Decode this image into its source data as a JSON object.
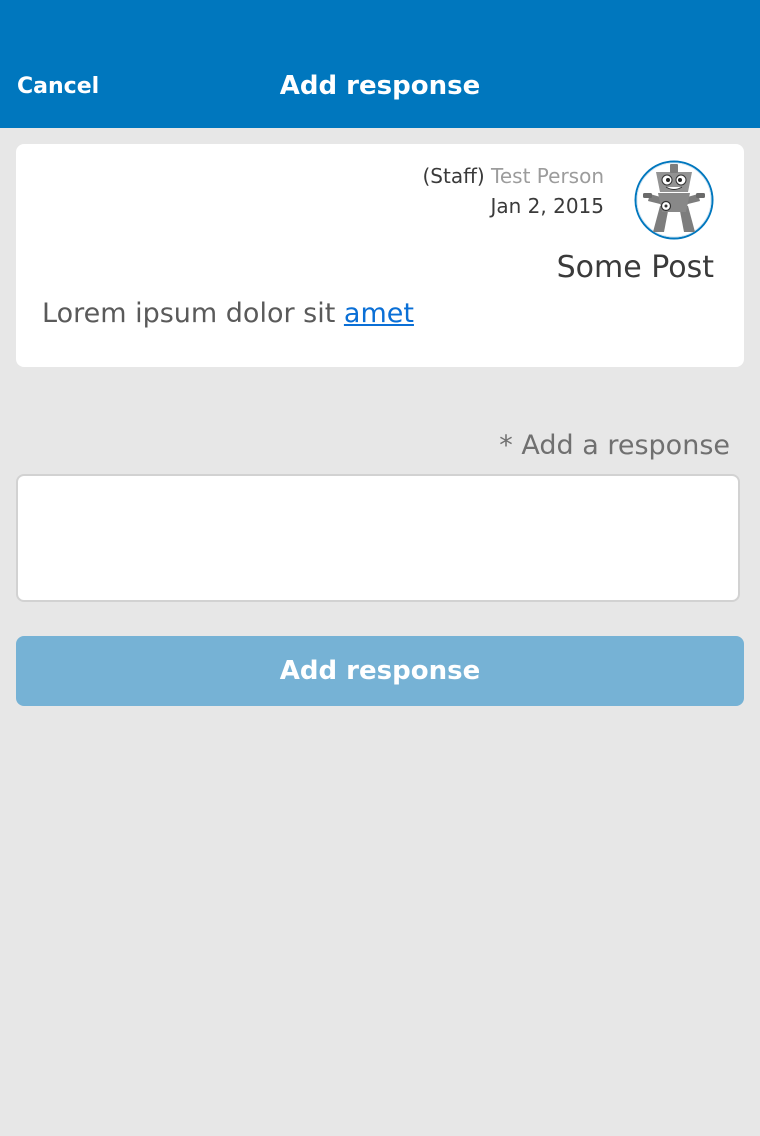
{
  "header": {
    "cancel_label": "Cancel",
    "title": "Add response",
    "background_color": "#0077be"
  },
  "post": {
    "author_role": "(Staff)",
    "author_name": "Test Person",
    "date": "Jan 2, 2015",
    "avatar_icon": "robot-avatar-icon",
    "title": "Some Post",
    "body_text": "Lorem ipsum dolor sit",
    "body_link": "amet"
  },
  "response": {
    "required_marker": "*",
    "label": "Add a response",
    "value": ""
  },
  "submit": {
    "label": "Add response",
    "color": "#76b2d5"
  },
  "colors": {
    "page_background": "#e7e7e7",
    "link": "#0a6fd6"
  }
}
